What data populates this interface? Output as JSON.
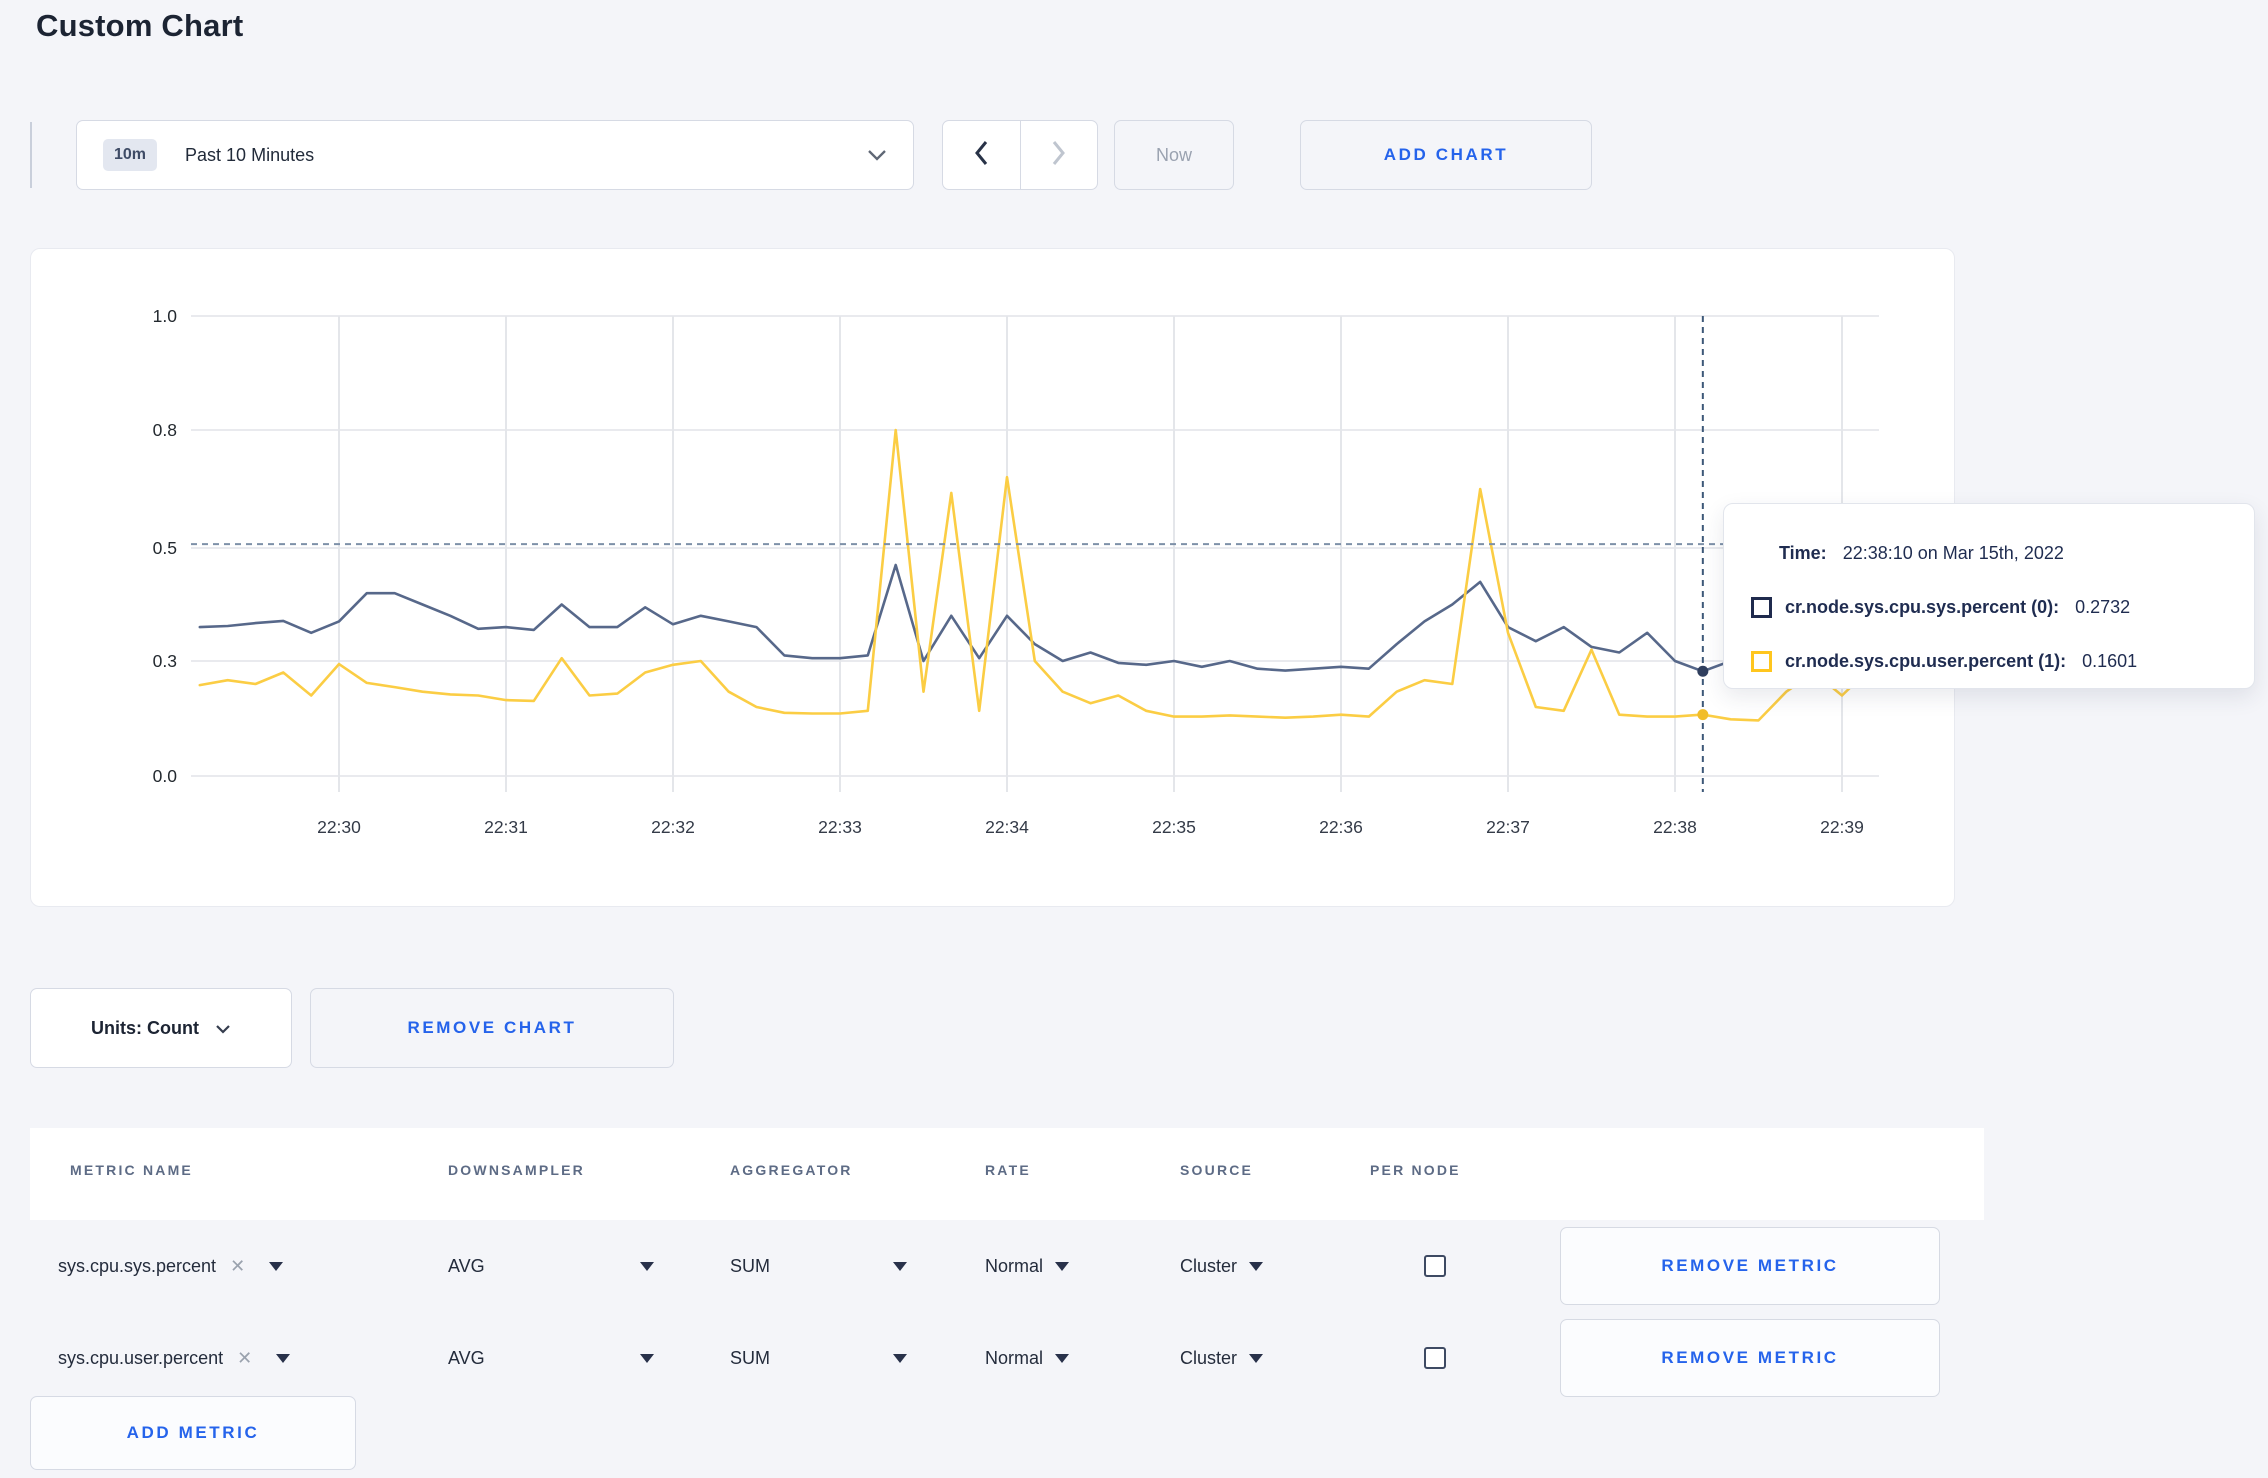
{
  "page": {
    "title": "Custom Chart"
  },
  "toolbar": {
    "time_window_badge": "10m",
    "time_window_label": "Past 10 Minutes",
    "now_label": "Now",
    "add_chart_label": "ADD CHART"
  },
  "tooltip": {
    "time_label": "Time:",
    "time_value": "22:38:10 on Mar 15th, 2022",
    "rows": [
      {
        "name": "cr.node.sys.cpu.sys.percent (0):",
        "value": "0.2732",
        "color": "#1f2a4d"
      },
      {
        "name": "cr.node.sys.cpu.user.percent (1):",
        "value": "0.1601",
        "color": "#ffc61e"
      }
    ]
  },
  "units_row": {
    "units_label": "Units: Count",
    "remove_chart_label": "REMOVE CHART"
  },
  "metrics_table": {
    "headers": [
      "METRIC NAME",
      "DOWNSAMPLER",
      "AGGREGATOR",
      "RATE",
      "SOURCE",
      "PER NODE"
    ],
    "rows": [
      {
        "metric": "sys.cpu.sys.percent",
        "downsampler": "AVG",
        "aggregator": "SUM",
        "rate": "Normal",
        "source": "Cluster",
        "per_node": false
      },
      {
        "metric": "sys.cpu.user.percent",
        "downsampler": "AVG",
        "aggregator": "SUM",
        "rate": "Normal",
        "source": "Cluster",
        "per_node": false
      }
    ],
    "remove_metric_label": "REMOVE METRIC",
    "add_metric_label": "ADD METRIC"
  },
  "chart_data": {
    "type": "line",
    "title": "",
    "xlabel": "",
    "ylabel": "",
    "x_start_time": "22:29:10",
    "x_interval_seconds": 10,
    "x_tick_labels": [
      "22:30",
      "22:31",
      "22:32",
      "22:33",
      "22:34",
      "22:35",
      "22:36",
      "22:37",
      "22:38",
      "22:39"
    ],
    "y_tick_labels": [
      "0.0",
      "0.3",
      "0.5",
      "0.8",
      "1.0"
    ],
    "y_tick_values": [
      0,
      0.3,
      0.5,
      0.8,
      1.0
    ],
    "grid": true,
    "legend_position": "tooltip",
    "series": [
      {
        "name": "cr.node.sys.cpu.sys.percent",
        "color": "#57688a",
        "dot_color": "#303f5e",
        "values": [
          0.36,
          0.362,
          0.367,
          0.371,
          0.35,
          0.37,
          0.42,
          0.42,
          0.4,
          0.38,
          0.357,
          0.36,
          0.355,
          0.4,
          0.36,
          0.36,
          0.395,
          0.365,
          0.38,
          0.37,
          0.36,
          0.31,
          0.305,
          0.305,
          0.31,
          0.47,
          0.3,
          0.38,
          0.305,
          0.38,
          0.33,
          0.3,
          0.315,
          0.295,
          0.29,
          0.3,
          0.285,
          0.3,
          0.28,
          0.275,
          0.28,
          0.285,
          0.28,
          0.33,
          0.37,
          0.4,
          0.44,
          0.36,
          0.335,
          0.36,
          0.325,
          0.315,
          0.35,
          0.3,
          0.2732,
          0.3,
          0.33,
          0.3,
          0.3,
          0.305,
          0.31
        ]
      },
      {
        "name": "cr.node.sys.cpu.user.percent",
        "color": "#fbcd44",
        "dot_color": "#f1bd2a",
        "values": [
          0.237,
          0.25,
          0.24,
          0.27,
          0.21,
          0.292,
          0.243,
          0.232,
          0.22,
          0.213,
          0.21,
          0.198,
          0.196,
          0.305,
          0.21,
          0.215,
          0.27,
          0.29,
          0.3,
          0.22,
          0.18,
          0.165,
          0.163,
          0.163,
          0.17,
          0.8,
          0.22,
          0.64,
          0.17,
          0.68,
          0.3,
          0.22,
          0.19,
          0.21,
          0.17,
          0.155,
          0.155,
          0.158,
          0.155,
          0.152,
          0.155,
          0.16,
          0.155,
          0.22,
          0.25,
          0.24,
          0.65,
          0.35,
          0.18,
          0.17,
          0.32,
          0.16,
          0.155,
          0.155,
          0.1601,
          0.148,
          0.145,
          0.22,
          0.27,
          0.21,
          0.28
        ]
      }
    ],
    "crosshair": {
      "index": 54,
      "time": "22:38:10",
      "hline_value": 0.51,
      "point_values": [
        0.2732,
        0.1601
      ]
    }
  }
}
